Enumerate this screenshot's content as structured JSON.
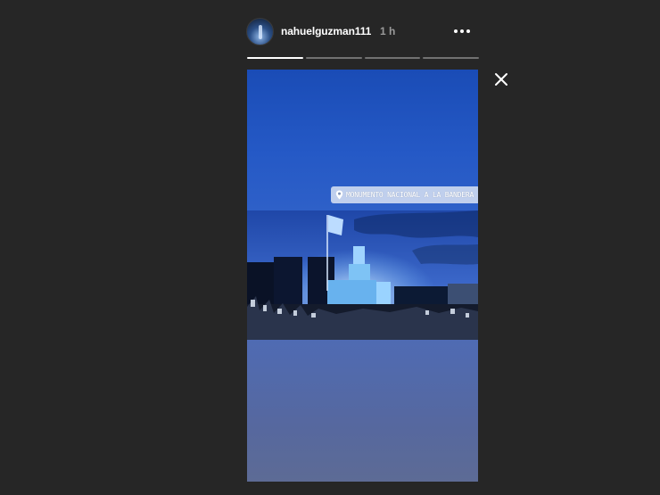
{
  "story": {
    "username": "nahuelguzman111",
    "time_ago": "1 h",
    "location": "MONUMENTO NACIONAL A LA BANDERA",
    "segments": [
      {
        "progress": 1.0
      },
      {
        "progress": 0.0
      },
      {
        "progress": 0.0
      },
      {
        "progress": 0.0
      }
    ]
  },
  "icons": {
    "avatar": "profile-avatar",
    "more": "more-options-icon",
    "close": "close-icon",
    "location": "location-pin-icon"
  },
  "colors": {
    "background": "#262626",
    "text": "#ffffff",
    "muted_text": "#9a9a9a",
    "sky_blue": "#2358c2"
  }
}
